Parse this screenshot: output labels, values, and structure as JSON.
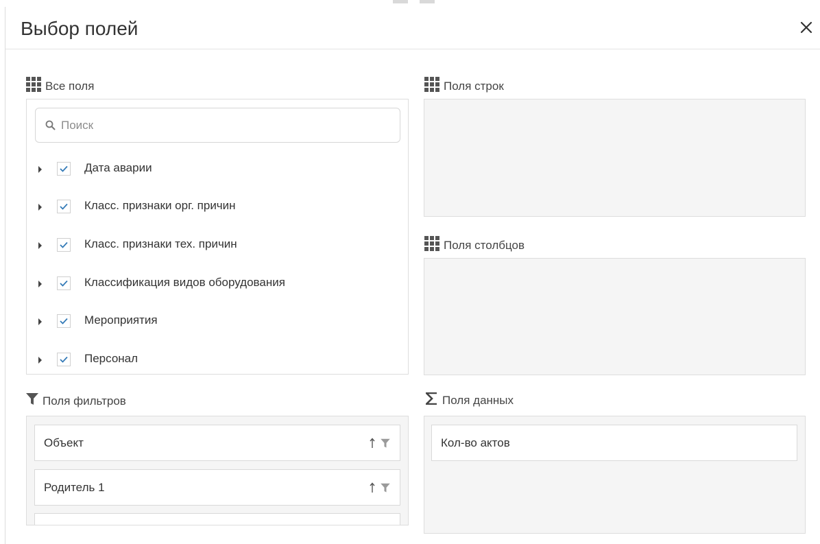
{
  "dialog": {
    "title": "Выбор полей",
    "close_icon": "close-icon"
  },
  "all_fields": {
    "label": "Все поля",
    "icon": "grid-icon",
    "search": {
      "placeholder": "Поиск",
      "value": "",
      "icon": "search-icon"
    },
    "items": [
      {
        "label": "Дата аварии",
        "checked": true
      },
      {
        "label": "Класс. признаки орг. причин",
        "checked": true
      },
      {
        "label": "Класс. признаки тех. причин",
        "checked": true
      },
      {
        "label": "Классификация видов оборудования",
        "checked": true
      },
      {
        "label": "Мероприятия",
        "checked": true
      },
      {
        "label": "Персонал",
        "checked": true
      }
    ]
  },
  "row_fields": {
    "label": "Поля строк",
    "icon": "grid-icon"
  },
  "column_fields": {
    "label": "Поля столбцов",
    "icon": "grid-icon"
  },
  "filter_fields": {
    "label": "Поля фильтров",
    "icon": "filter-icon",
    "items": [
      {
        "label": "Объект"
      },
      {
        "label": "Родитель 1"
      }
    ]
  },
  "data_fields": {
    "label": "Поля данных",
    "icon": "sigma-icon",
    "items": [
      {
        "label": "Кол-во актов"
      }
    ]
  },
  "colors": {
    "check": "#337ab7",
    "panel_bg": "#f5f5f5",
    "border": "#dddddd",
    "icon": "#555555"
  }
}
